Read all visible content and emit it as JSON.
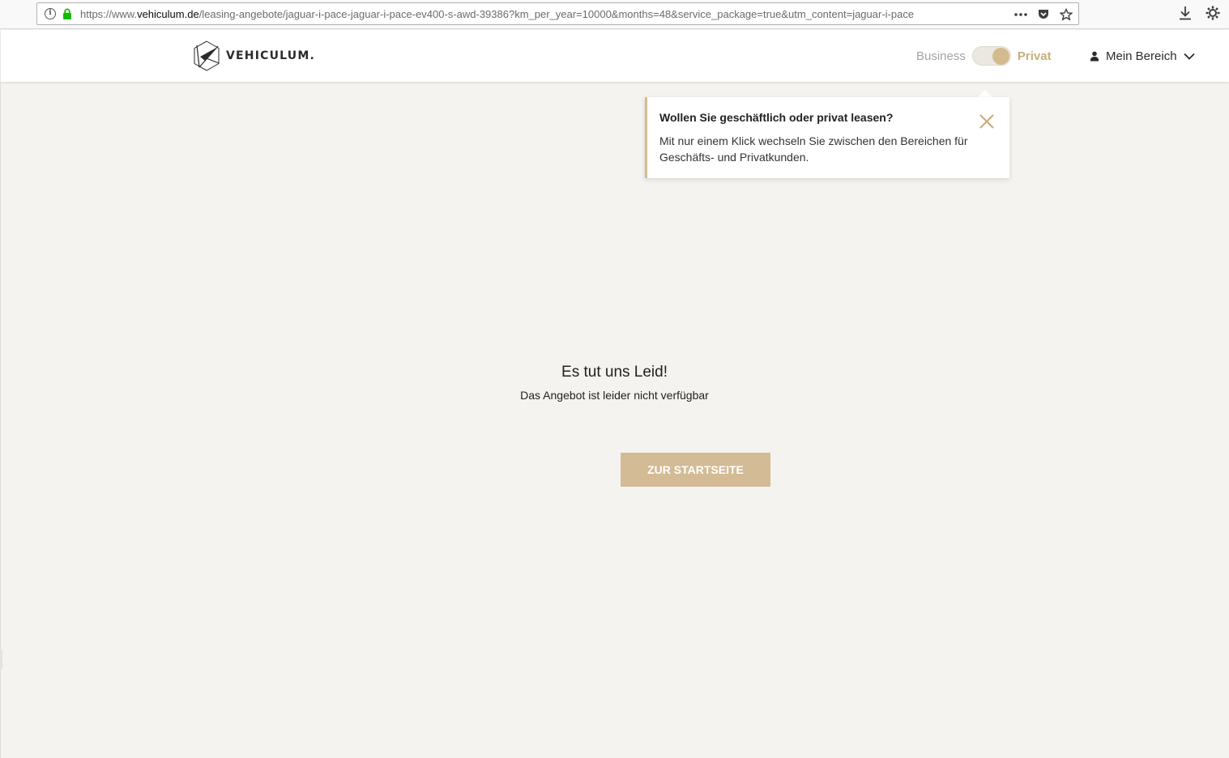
{
  "browser": {
    "url_scheme": "https://www.",
    "url_host": "vehiculum.de",
    "url_path": "/leasing-angebote/jaguar-i-pace-jaguar-i-pace-ev400-s-awd-39386?km_per_year=10000&months=48&service_package=true&utm_content=jaguar-i-pace",
    "icons": [
      "info-icon",
      "lock-icon",
      "more-icon",
      "pocket-icon",
      "bookmark-star-icon",
      "download-icon",
      "settings-icon"
    ]
  },
  "header": {
    "logo_text": "VEHICULUM.",
    "toggle_business": "Business",
    "toggle_privat": "Privat",
    "toggle_state": "Privat",
    "account_label": "Mein Bereich"
  },
  "tooltip": {
    "title": "Wollen Sie geschäftlich oder privat leasen?",
    "body": "Mit nur einem Klick wechseln Sie zwischen den Bereichen für Geschäfts- und Privatkunden."
  },
  "main": {
    "title": "Es tut uns Leid!",
    "subtitle": "Das Angebot ist leider nicht verfügbar",
    "button_label": "ZUR STARTSEITE"
  },
  "colors": {
    "accent": "#d3bb8f",
    "button": "#d3bb95",
    "background": "#f5f3ef"
  }
}
